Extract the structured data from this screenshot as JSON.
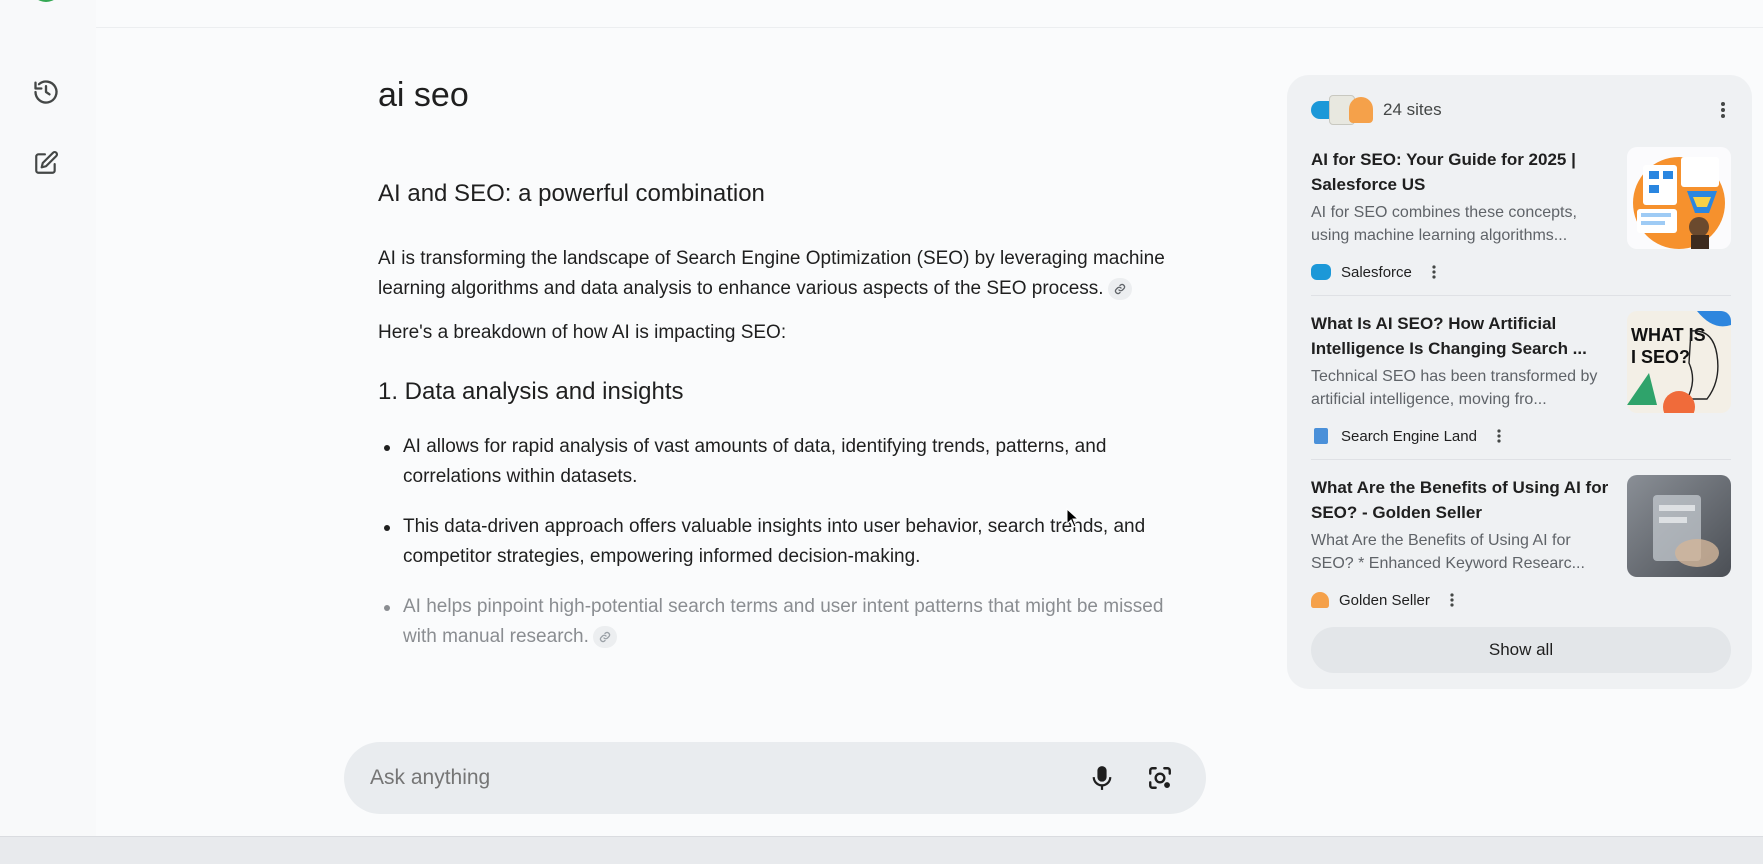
{
  "query": "ai seo",
  "answer": {
    "heading": "AI and SEO: a powerful combination",
    "intro": "AI is transforming the landscape of Search Engine Optimization (SEO) by leveraging machine learning algorithms and data analysis to enhance various aspects of the SEO process.",
    "breakdown": "Here's a breakdown of how AI is impacting SEO:",
    "section1_title": "1. Data analysis and insights",
    "bullets": [
      "AI allows for rapid analysis of vast amounts of data, identifying trends, patterns, and correlations within datasets.",
      "This data-driven approach offers valuable insights into user behavior, search trends, and competitor strategies, empowering informed decision-making.",
      "AI helps pinpoint high-potential search terms and user intent patterns that might be missed with manual research."
    ]
  },
  "ask": {
    "placeholder": "Ask anything"
  },
  "sources": {
    "count_label": "24 sites",
    "cards": [
      {
        "title": "AI for SEO: Your Guide for 2025 | Salesforce US",
        "snippet": "AI for SEO combines these concepts, using machine learning algorithms...",
        "source": "Salesforce",
        "fav_color": "#1c98d8"
      },
      {
        "title": "What Is AI SEO? How Artificial Intelligence Is Changing Search ...",
        "snippet": "Technical SEO has been transformed by artificial intelligence, moving fro...",
        "source": "Search Engine Land",
        "fav_color": "#4a90d9",
        "thumb_text": "WHAT IS\nI SEO?"
      },
      {
        "title": "What Are the Benefits of Using AI for SEO? - Golden Seller",
        "snippet": "What Are the Benefits of Using AI for SEO? * Enhanced Keyword Researc...",
        "source": "Golden Seller",
        "fav_color": "#f5a14a"
      }
    ],
    "show_all_label": "Show all"
  },
  "colors": {
    "accent_green": "#34a853",
    "salesforce_blue": "#1c98d8",
    "golden_orange": "#f5a14a"
  }
}
